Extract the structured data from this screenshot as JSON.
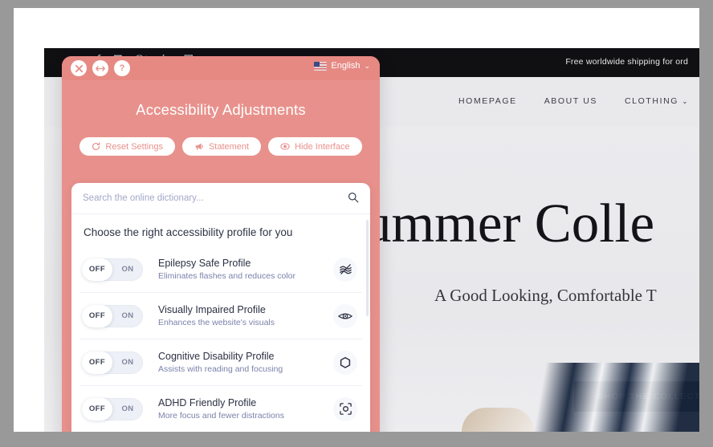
{
  "site": {
    "social_icons": [
      "facebook-icon",
      "twitter-icon",
      "google-plus-icon",
      "linkedin-icon",
      "instagram-icon"
    ],
    "social_glyphs": [
      "f",
      "✉",
      "G+",
      "in",
      "▣"
    ],
    "shipping_note": "Free worldwide shipping for ord",
    "nav": [
      {
        "label": "HOMEPAGE",
        "has_chevron": false
      },
      {
        "label": "ABOUT US",
        "has_chevron": false
      },
      {
        "label": "CLOTHING",
        "has_chevron": true
      }
    ],
    "hero": {
      "title": "ummer Colle",
      "subtitle": "A Good Looking, Comfortable T",
      "cta": "SHOP THE COLLECTION"
    },
    "chevron_glyph": "⌄"
  },
  "panel": {
    "topbar": {
      "close_label": "×",
      "move_label": "↔",
      "help_label": "?",
      "language": "English",
      "language_chevron": "⌄"
    },
    "title": "Accessibility Adjustments",
    "actions": [
      {
        "label": "Reset Settings",
        "icon": "refresh-icon"
      },
      {
        "label": "Statement",
        "icon": "megaphone-icon"
      },
      {
        "label": "Hide Interface",
        "icon": "eye-off-icon"
      }
    ],
    "accent_color": "#e8918c",
    "search": {
      "placeholder": "Search the online dictionary...",
      "value": "",
      "icon": "search-icon"
    },
    "card_heading": "Choose the right accessibility profile for you",
    "toggle": {
      "off_label": "OFF",
      "on_label": "ON"
    },
    "profiles": [
      {
        "name": "Epilepsy Safe Profile",
        "desc": "Eliminates flashes and reduces color",
        "icon": "epilepsy-waves-icon",
        "state": "OFF"
      },
      {
        "name": "Visually Impaired Profile",
        "desc": "Enhances the website's visuals",
        "icon": "eye-icon",
        "state": "OFF"
      },
      {
        "name": "Cognitive Disability Profile",
        "desc": "Assists with reading and focusing",
        "icon": "hexagon-icon",
        "state": "OFF"
      },
      {
        "name": "ADHD Friendly Profile",
        "desc": "More focus and fewer distractions",
        "icon": "focus-target-icon",
        "state": "OFF"
      }
    ]
  }
}
